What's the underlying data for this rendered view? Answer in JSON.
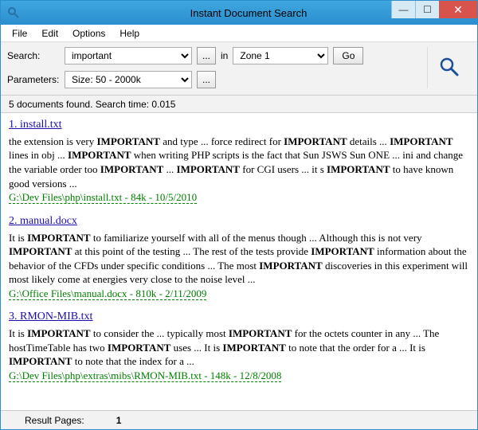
{
  "window": {
    "title": "Instant Document Search"
  },
  "menu": {
    "file": "File",
    "edit": "Edit",
    "options": "Options",
    "help": "Help"
  },
  "toolbar": {
    "search_label": "Search:",
    "search_value": "important",
    "browse_label": "...",
    "in_label": "in",
    "zone_value": "Zone 1",
    "go_label": "Go",
    "params_label": "Parameters:",
    "params_value": "Size: 50 - 2000k",
    "params_browse_label": "..."
  },
  "status": {
    "text": "5 documents found. Search time: 0.015"
  },
  "results": [
    {
      "num": "1.",
      "title": "install.txt",
      "snippet_html": "the extension is very <b>IMPORTANT</b> and type ... force redirect for <b>IMPORTANT</b> details ... <b>IMPORTANT</b> lines in obj ... <b>IMPORTANT</b> when writing PHP scripts is the fact that Sun JSWS Sun ONE ... ini and change the variable order too <b>IMPORTANT</b> ... <b>IMPORTANT</b> for CGI users ... it s <b>IMPORTANT</b> to have known good versions ...",
      "meta": "G:\\Dev Files\\php\\install.txt - 84k - 10/5/2010"
    },
    {
      "num": "2.",
      "title": "manual.docx",
      "snippet_html": "It is <b>IMPORTANT</b> to familiarize yourself with all of the menus though ... Although this is not very <b>IMPORTANT</b> at this point of the testing ... The rest of the tests provide <b>IMPORTANT</b> information about the behavior of the CFDs under specific conditions ... The most <b>IMPORTANT</b> discoveries in this experiment will most likely come at energies very close to the noise level ...",
      "meta": "G:\\Office Files\\manual.docx - 810k - 2/11/2009"
    },
    {
      "num": "3.",
      "title": "RMON-MIB.txt",
      "snippet_html": "It is <b>IMPORTANT</b> to consider the ... typically most <b>IMPORTANT</b> for the octets counter in any ... The hostTimeTable has two <b>IMPORTANT</b> uses ... It is <b>IMPORTANT</b> to note that the order for a ... It is <b>IMPORTANT</b> to note that the index for a ...",
      "meta": "G:\\Dev Files\\php\\extras\\mibs\\RMON-MIB.txt - 148k - 12/8/2008"
    }
  ],
  "pager": {
    "label": "Result Pages:",
    "current": "1"
  }
}
